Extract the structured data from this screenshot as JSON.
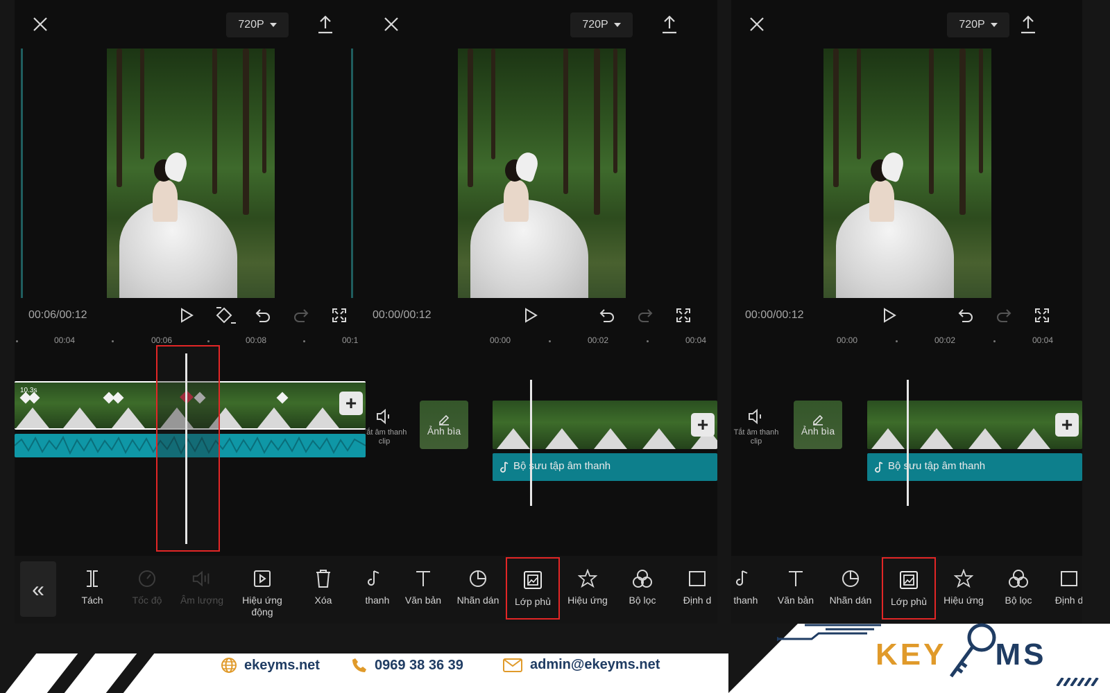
{
  "resolution_label": "720P",
  "panels": [
    {
      "time": "00:06/00:12",
      "ruler": [
        "00:04",
        "00:06",
        "00:08",
        "00:1"
      ],
      "clip_duration": "10.3s"
    },
    {
      "time": "00:00/00:12",
      "ruler": [
        "00:00",
        "00:02",
        "00:04"
      ],
      "mute_label": "Tắt âm thanh clip",
      "cover_label": "Ảnh bìa",
      "audio_label": "Bộ sưu tập âm thanh"
    },
    {
      "time": "00:00/00:12",
      "ruler": [
        "00:00",
        "00:02",
        "00:04"
      ],
      "mute_label": "Tắt âm thanh clip",
      "cover_label": "Ảnh bìa",
      "audio_label": "Bộ sưu tập âm thanh"
    }
  ],
  "toolbar1": [
    {
      "label": "Tách",
      "icon": "split-icon",
      "dim": false
    },
    {
      "label": "Tốc độ",
      "icon": "speed-icon",
      "dim": true
    },
    {
      "label": "Âm lượng",
      "icon": "volume-icon",
      "dim": true
    },
    {
      "label": "Hiệu ứng động",
      "icon": "animation-icon",
      "dim": false
    },
    {
      "label": "Xóa",
      "icon": "delete-icon",
      "dim": false
    }
  ],
  "toolbar2": [
    {
      "label": "n thanh",
      "icon": "music-note-icon"
    },
    {
      "label": "Văn bản",
      "icon": "text-icon"
    },
    {
      "label": "Nhãn dán",
      "icon": "sticker-icon"
    },
    {
      "label": "Lớp phủ",
      "icon": "overlay-icon",
      "highlight": true
    },
    {
      "label": "Hiệu ứng",
      "icon": "effects-icon"
    },
    {
      "label": "Bộ lọc",
      "icon": "filter-icon"
    },
    {
      "label": "Định d",
      "icon": "format-icon"
    }
  ],
  "toolbar3": [
    {
      "label": "n thanh",
      "icon": "music-note-icon"
    },
    {
      "label": "Văn bản",
      "icon": "text-icon"
    },
    {
      "label": "Nhãn dán",
      "icon": "sticker-icon"
    },
    {
      "label": "Lớp phủ",
      "icon": "overlay-icon",
      "highlight": true
    },
    {
      "label": "Hiệu ứng",
      "icon": "effects-icon"
    },
    {
      "label": "Bộ lọc",
      "icon": "filter-icon"
    },
    {
      "label": "Định d",
      "icon": "format-icon"
    }
  ],
  "banner": {
    "website": "ekeyms.net",
    "phone": "0969 38 36 39",
    "email": "admin@ekeyms.net",
    "logo": "KEYMS"
  },
  "colors": {
    "accent_red": "#e32626",
    "audio_cyan": "#0f97a6",
    "brand_navy": "#1f3c63",
    "brand_orange": "#e09a2a"
  }
}
